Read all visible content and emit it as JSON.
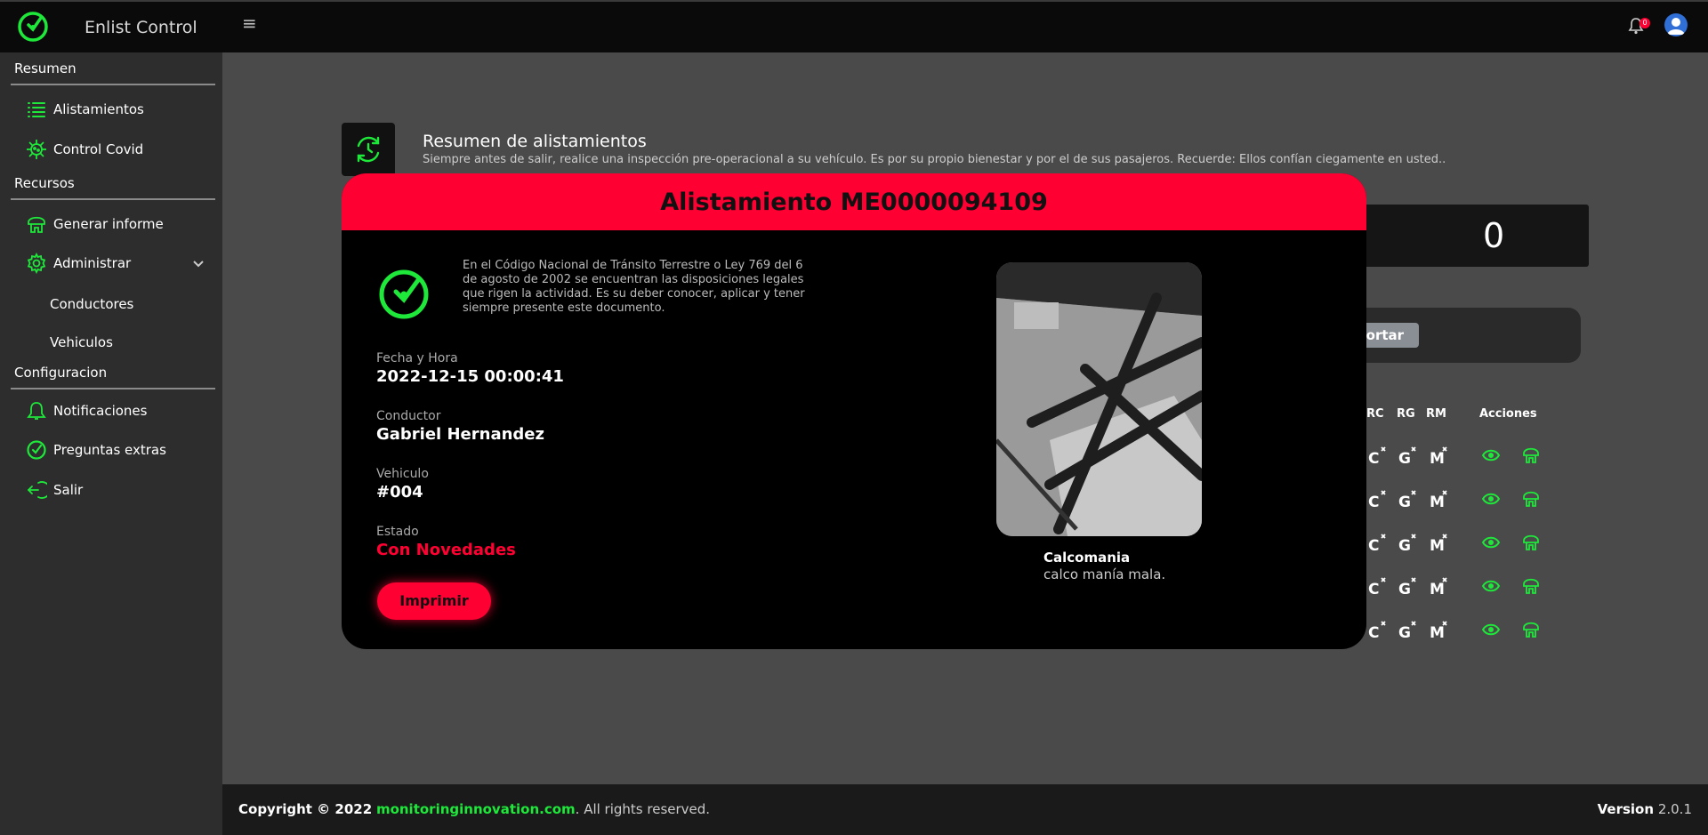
{
  "app": {
    "name": "Enlist Control",
    "notification_count": "0"
  },
  "colors": {
    "accent": "#1ee83a",
    "danger": "#ff0033",
    "sidebar_bg": "#2d2d2d",
    "topbar_bg": "#0a0a0a"
  },
  "sidebar": {
    "sections": [
      {
        "title": "Resumen"
      },
      {
        "title": "Recursos"
      },
      {
        "title": "Configuracion"
      }
    ],
    "items": [
      {
        "label": "Alistamientos",
        "icon": "list-icon"
      },
      {
        "label": "Control Covid",
        "icon": "virus-icon"
      },
      {
        "label": "Generar informe",
        "icon": "report-icon"
      },
      {
        "label": "Administrar",
        "icon": "gear-icon"
      },
      {
        "label": "Notificaciones",
        "icon": "bell-icon"
      },
      {
        "label": "Preguntas extras",
        "icon": "check-icon"
      },
      {
        "label": "Salir",
        "icon": "logout-icon"
      }
    ],
    "subitems": [
      {
        "label": "Conductores"
      },
      {
        "label": "Vehiculos"
      }
    ]
  },
  "page": {
    "title": "Resumen de alistamientos",
    "subtitle": "Siempre antes de salir, realice una inspección pre-operacional a su vehículo. Es por su propio bienestar y por el de sus pasajeros. Recuerde: Ellos confían ciegamente en usted..",
    "count": "0",
    "export_label": "Exportar",
    "table_headers": [
      "RC",
      "RG",
      "RM",
      "Acciones"
    ]
  },
  "modal": {
    "title": "Alistamiento ME0000094109",
    "legal_text": "En el Código Nacional de Tránsito Terrestre o Ley 769 del 6 de agosto de 2002 se encuentran las disposiciones legales que rigen la actividad. Es su deber conocer, aplicar y tener siempre presente este documento.",
    "fields": [
      {
        "label": "Fecha y Hora",
        "value": "2022-12-15 00:00:41"
      },
      {
        "label": "Conductor",
        "value": "Gabriel Hernandez"
      },
      {
        "label": "Vehiculo",
        "value": "#004"
      },
      {
        "label": "Estado",
        "value": "Con Novedades"
      }
    ],
    "print_label": "Imprimir",
    "photo": {
      "title": "Calcomania",
      "description": "calco manía mala."
    }
  },
  "footer": {
    "copyright": "Copyright © 2022",
    "link": "monitoringinnovation.com",
    "rights": ". All rights reserved.",
    "version_label": "Version",
    "version": "2.0.1"
  }
}
